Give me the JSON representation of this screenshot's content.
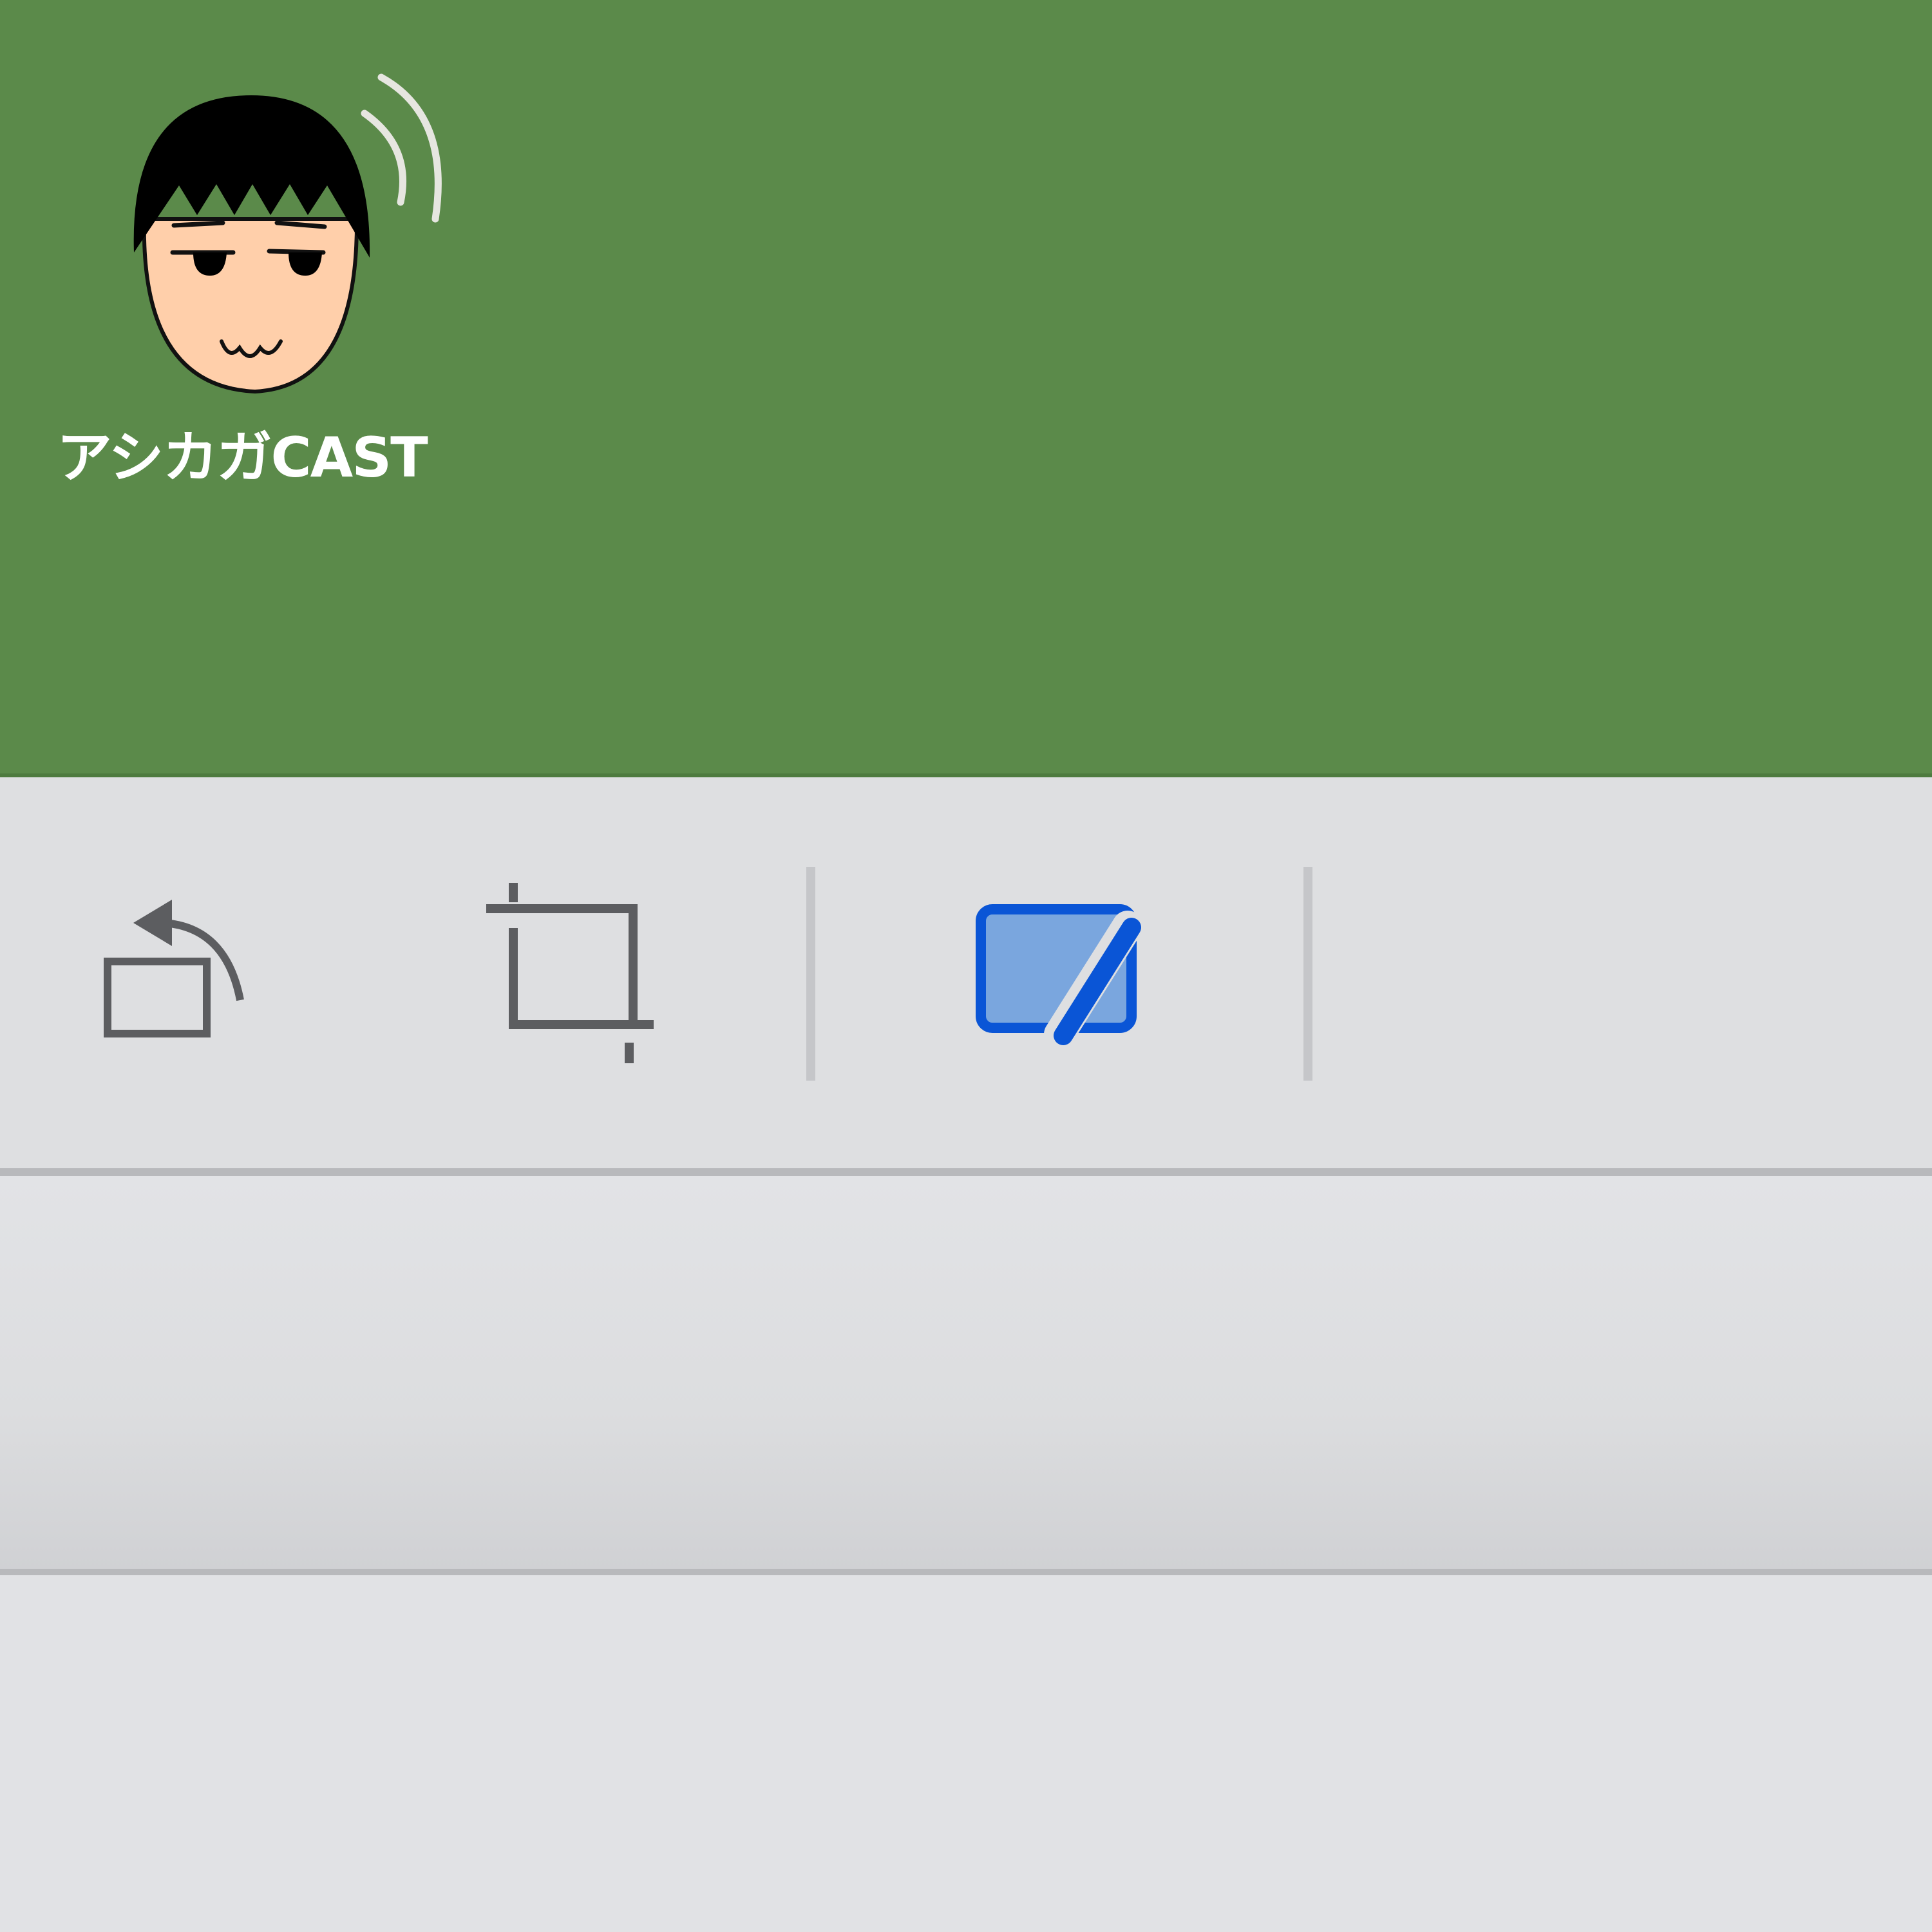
{
  "logo": {
    "text": "アシカガCAST"
  },
  "toolbar": {
    "tools": [
      {
        "name": "rotate",
        "icon": "rotate-icon",
        "color": "#5c5d60"
      },
      {
        "name": "crop",
        "icon": "crop-icon",
        "color": "#5c5d60"
      },
      {
        "name": "markup",
        "icon": "markup-edit-icon",
        "color": "#0a55d6",
        "fill": "#7aa6de",
        "active": true
      }
    ]
  },
  "colors": {
    "image_background": "#5b8a4a",
    "toolbar_background": "#dedfe1",
    "accent": "#0a55d6"
  }
}
